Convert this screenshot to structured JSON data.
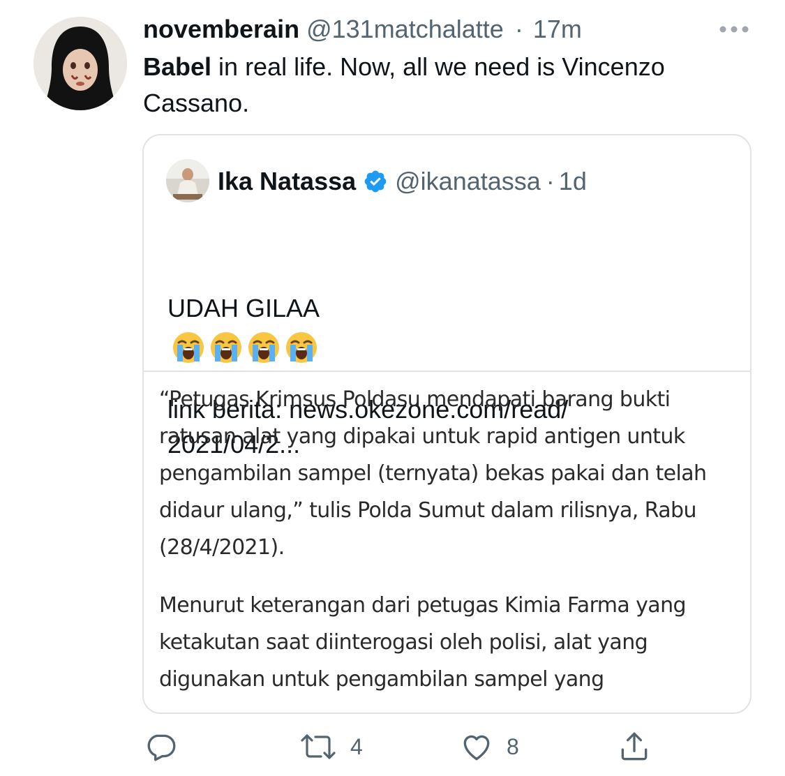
{
  "tweet": {
    "author_name": "novemberain",
    "author_handle": "@131matchalatte",
    "separator": "·",
    "time": "17m",
    "text_bold": "Babel",
    "text_rest": " in real life. Now, all we need is Vincenzo Cassano."
  },
  "quoted": {
    "author_name": "Ika Natassa",
    "author_handle": "@ikanatassa",
    "separator": "·",
    "time": "1d",
    "line1": "UDAH GILAA",
    "emoji_name": "loudly-crying-face-icon",
    "link_text": "link berita: news.okezone.com/read/\n2021/04/2...",
    "article_p1": "“Petugas Krimsus Poldasu mendapati barang bukti ratusan alat yang dipakai untuk rapid antigen untuk pengambilan sampel (ternyata) bekas pakai dan telah didaur ulang,” tulis Polda Sumut dalam rilisnya, Rabu (28/4/2021).",
    "article_p2": "Menurut keterangan dari petugas Kimia Farma yang ketakutan saat diinterogasi oleh polisi, alat yang digunakan untuk pengambilan sampel yang"
  },
  "actions": {
    "reply_icon": "reply-icon",
    "retweet_count": "4",
    "like_count": "8",
    "share_icon": "share-icon"
  },
  "colors": {
    "text_primary": "#0f1419",
    "text_secondary": "#536471",
    "verified_blue": "#1d9bf0",
    "border": "#dfe3e6"
  }
}
